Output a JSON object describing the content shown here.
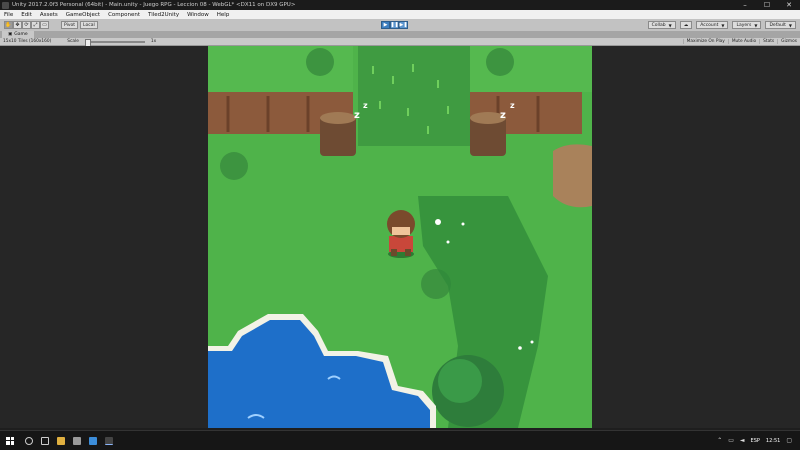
{
  "window": {
    "title": "Unity 2017.2.0f3 Personal (64bit) - Main.unity - Juego RPG - Leccion 08 - WebGL* <DX11 on DX9 GPU>",
    "controls": [
      "–",
      "☐",
      "✕"
    ]
  },
  "menu": [
    "File",
    "Edit",
    "Assets",
    "GameObject",
    "Component",
    "Tiled2Unity",
    "Window",
    "Help"
  ],
  "toolbar": {
    "tools": [
      "✋",
      "✥",
      "⟳",
      "⤢",
      "▭"
    ],
    "pivot": "Pivot",
    "local": "Local",
    "collab": "Collab",
    "cloud_icon": "cloud-icon",
    "account": "Account",
    "layers": "Layers",
    "layout": "Default"
  },
  "game_tab": {
    "label": "Game",
    "resolution": "15x10 Tiles (160x160)",
    "scale_label": "Scale",
    "scale_value": "1x",
    "options": [
      "Maximize On Play",
      "Mute Audio",
      "Stats",
      "Gizmos"
    ]
  },
  "taskbar": {
    "language": "ESP",
    "time": "12:51"
  },
  "colors": {
    "grass": "#4fb34a",
    "dark_grass": "#2f8a3a",
    "water": "#1e6fc9",
    "cliff": "#8c5a3c",
    "accent": "#3d7fc0"
  }
}
